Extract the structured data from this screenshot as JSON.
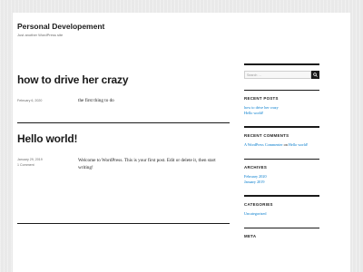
{
  "site": {
    "title": "Personal Developement",
    "description": "Just another WordPress site"
  },
  "posts": [
    {
      "title": "how to drive her crazy",
      "date": "February 6, 2020",
      "comments": "",
      "content": "the first thing to do"
    },
    {
      "title": "Hello world!",
      "date": "January 29, 2019",
      "comments": "1 Comment",
      "content": "Welcome to WordPress. This is your first post. Edit or delete it, then start writing!"
    }
  ],
  "sidebar": {
    "search_placeholder": "Search …",
    "recent_posts": {
      "title": "RECENT POSTS",
      "items": [
        "how to drive her crazy",
        "Hello world!"
      ]
    },
    "recent_comments": {
      "title": "RECENT COMMENTS",
      "author": "A WordPress Commenter",
      "on": "on",
      "post": "Hello world!"
    },
    "archives": {
      "title": "ARCHIVES",
      "items": [
        "February 2020",
        "January 2019"
      ]
    },
    "categories": {
      "title": "CATEGORIES",
      "items": [
        "Uncategorized"
      ]
    },
    "meta": {
      "title": "META"
    }
  },
  "colors": {
    "link": "#007acc",
    "text": "#1a1a1a",
    "muted": "#686868",
    "background": "#e9e9e9"
  },
  "icons": {
    "search_button": "search-icon"
  }
}
